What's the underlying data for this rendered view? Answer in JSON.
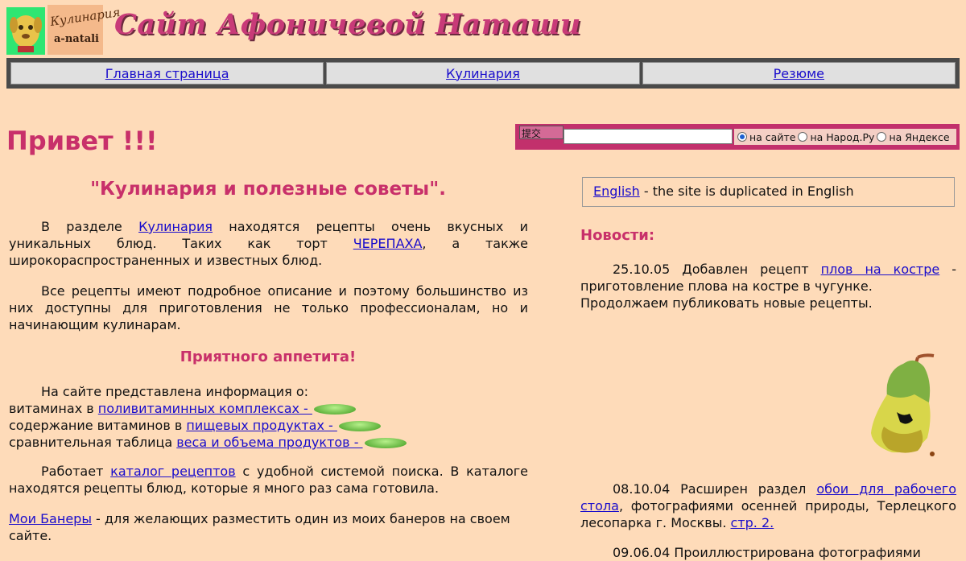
{
  "header": {
    "logo_text_1": "Кулинария",
    "logo_text_2": "a-natali",
    "site_title": "Сайт Афоничевой Наташи"
  },
  "nav": {
    "items": [
      {
        "label": "Главная страница"
      },
      {
        "label": "Кулинария"
      },
      {
        "label": "Резюме"
      }
    ]
  },
  "greeting": "Привет !!!",
  "search": {
    "button_label": "提交",
    "input_value": "",
    "options": [
      {
        "label": "на сайте",
        "selected": true
      },
      {
        "label": "на Народ.Ру",
        "selected": false
      },
      {
        "label": "на Яндексе",
        "selected": false
      }
    ]
  },
  "main": {
    "heading": "\"Кулинария и полезные советы\".",
    "p1": {
      "before": "В разделе ",
      "link1": "Кулинария",
      "middle": " находятся рецепты очень вкусных и уникальных блюд. Таких как торт ",
      "link2": "ЧЕРЕПАХА",
      "after": ", а также широкораспространенных и известных блюд."
    },
    "p2": "Все рецепты имеют подробное описание и поэтому большинство из них доступны для приготовления не только профессионалам, но и начинающим кулинарам.",
    "appetite": "Приятного аппетита!",
    "p3": {
      "intro": "На сайте представлена информация о:",
      "line1_text": "витаминах в ",
      "line1_link": "поливитаминных комплексах - ",
      "line2_text": "содержание витаминов в ",
      "line2_link": "пищевых продуктах - ",
      "line3_text": "сравнительная таблица ",
      "line3_link": "веса и объема продуктов - "
    },
    "p4": {
      "before": "Работает ",
      "link": "каталог рецептов",
      "after": " с удобной системой поиска. В каталоге находятся рецепты блюд, которые я много раз сама готовила."
    },
    "p5": {
      "link": "Мои Банеры",
      "after": " - для желающих разместить один из моих банеров на своем сайте."
    }
  },
  "sidebar": {
    "english_link": "English",
    "english_text": " - the site is duplicated in English",
    "news_title": "Новости:",
    "news": [
      {
        "date": "25.10.05",
        "before": " Добавлен рецепт ",
        "link": "плов на костре",
        "after": " - приготовление плова на костре в чугунке.",
        "extra": "Продолжаем публиковать новые рецепты."
      },
      {
        "date": "08.10.04",
        "before": " Расширен раздел ",
        "link": "обои для рабочего стола",
        "after": ", фотографиями осенней природы, Терлецкого лесопарка г. Москвы. ",
        "link2": "стр. 2."
      },
      {
        "date": "09.06.04",
        "text": " Проиллюстрирована фотографиями"
      }
    ]
  },
  "colors": {
    "background": "#fedbb9",
    "accent": "#c8306a",
    "link": "#1a0dcc"
  }
}
